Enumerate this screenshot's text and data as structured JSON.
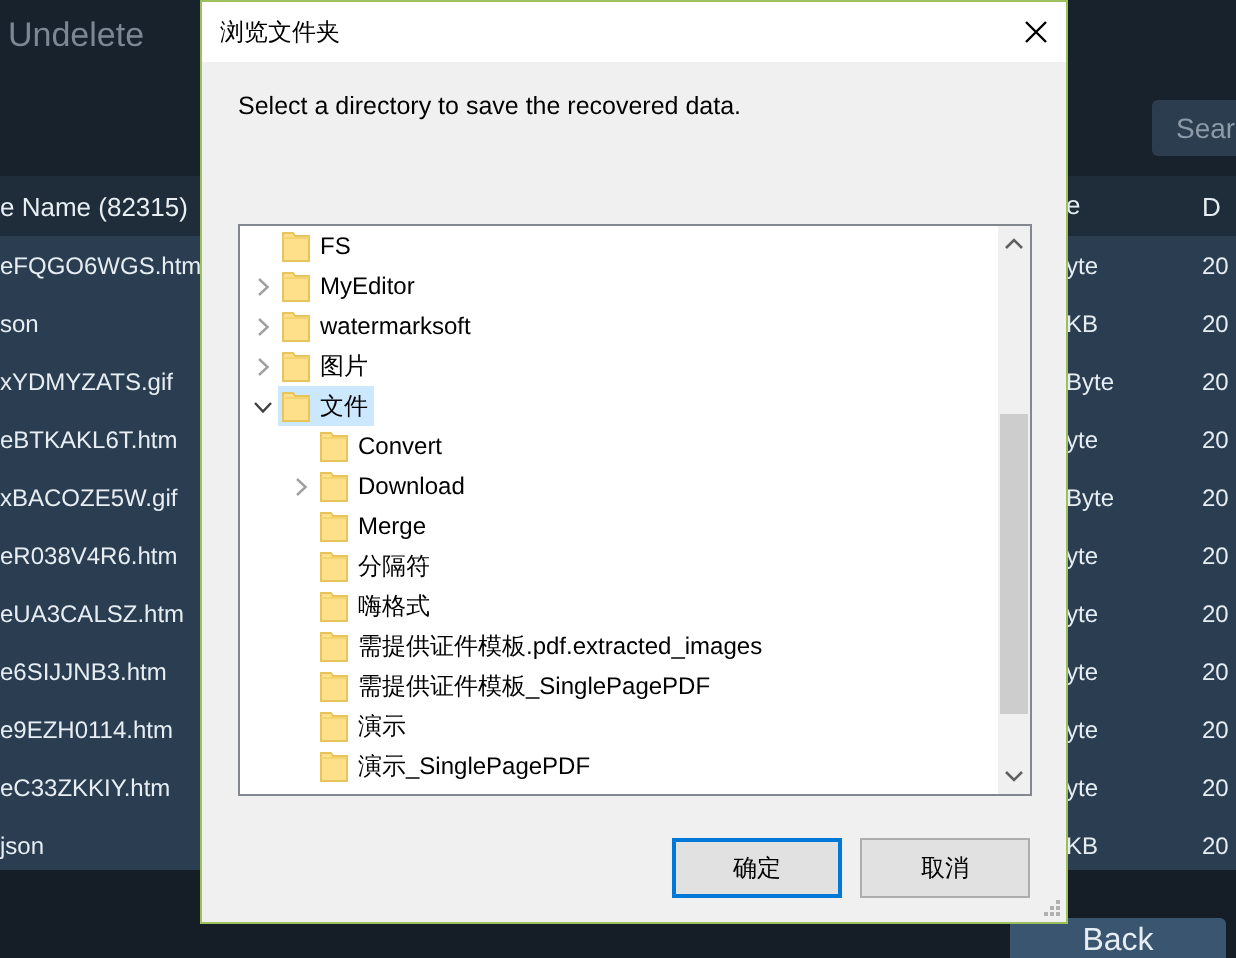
{
  "app": {
    "title": "Undelete",
    "search": {
      "placeholder": "Sear"
    },
    "table": {
      "columns": [
        "e Name (82315)",
        "e",
        "D"
      ],
      "rows": [
        [
          "eFQGO6WGS.htm",
          "yte",
          "20"
        ],
        [
          "son",
          "KB",
          "20"
        ],
        [
          "xYDMYZATS.gif",
          "Byte",
          "20"
        ],
        [
          "eBTKAKL6T.htm",
          "yte",
          "20"
        ],
        [
          "xBACOZE5W.gif",
          "Byte",
          "20"
        ],
        [
          "eR038V4R6.htm",
          "yte",
          "20"
        ],
        [
          "eUA3CALSZ.htm",
          "yte",
          "20"
        ],
        [
          "e6SIJJNB3.htm",
          "yte",
          "20"
        ],
        [
          "e9EZH0114.htm",
          "yte",
          "20"
        ],
        [
          "eC33ZKKIY.htm",
          "yte",
          "20"
        ],
        [
          "json",
          "KB",
          "20"
        ]
      ]
    },
    "buttons": [
      "Back"
    ]
  },
  "dialog": {
    "title": "浏览文件夹",
    "message": "Select a directory to save the recovered data.",
    "tree": [
      {
        "label": "FS",
        "selected": false
      },
      {
        "label": "MyEditor",
        "selected": false,
        "expanded": false
      },
      {
        "label": "watermarksoft",
        "selected": false,
        "expanded": false
      },
      {
        "label": "图片",
        "selected": false,
        "expanded": false
      },
      {
        "label": "文件",
        "selected": true,
        "expanded": true,
        "children": [
          {
            "label": "Convert",
            "selected": false
          },
          {
            "label": "Download",
            "selected": false,
            "expanded": false
          },
          {
            "label": "Merge",
            "selected": false
          },
          {
            "label": "分隔符",
            "selected": false
          },
          {
            "label": "嗨格式",
            "selected": false
          },
          {
            "label": "需提供证件模板.pdf.extracted_images",
            "selected": false
          },
          {
            "label": "需提供证件模板_SinglePagePDF",
            "selected": false
          },
          {
            "label": "演示",
            "selected": false
          },
          {
            "label": "演示_SinglePagePDF",
            "selected": false
          }
        ]
      }
    ],
    "buttons": [
      {
        "label": "确定",
        "focused": true
      },
      {
        "label": "取消",
        "focused": false
      }
    ]
  }
}
